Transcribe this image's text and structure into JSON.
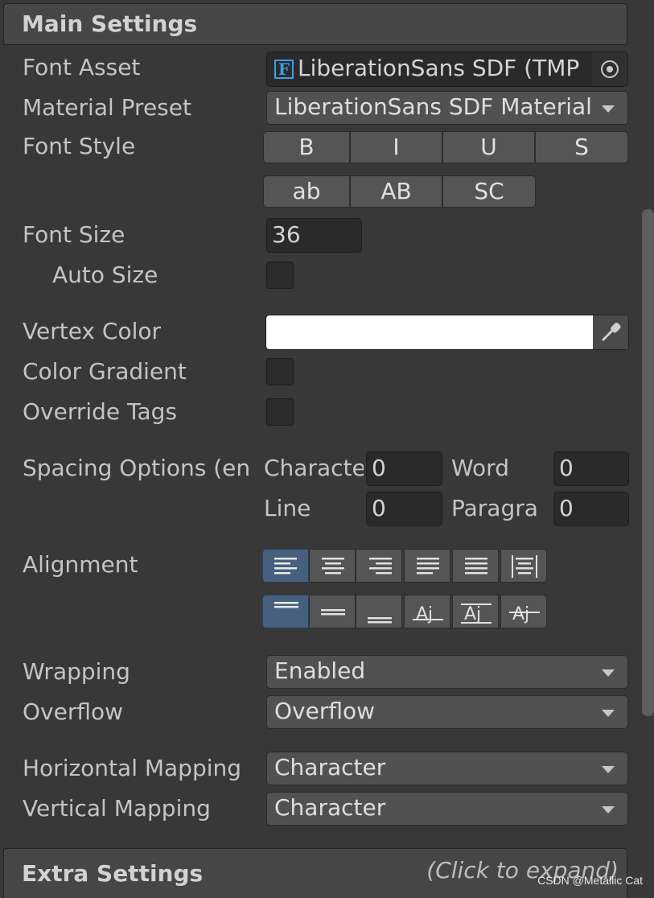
{
  "main_settings": {
    "title": "Main Settings"
  },
  "font_asset": {
    "label": "Font Asset",
    "value": "LiberationSans SDF (TMP",
    "icon": "F"
  },
  "material_preset": {
    "label": "Material Preset",
    "value": "LiberationSans SDF Material"
  },
  "font_style": {
    "label": "Font Style",
    "row1": [
      "B",
      "I",
      "U",
      "S"
    ],
    "row2": [
      "ab",
      "AB",
      "SC"
    ]
  },
  "font_size": {
    "label": "Font Size",
    "value": "36"
  },
  "auto_size": {
    "label": "Auto Size",
    "checked": false
  },
  "vertex_color": {
    "label": "Vertex Color",
    "color": "#ffffff"
  },
  "color_gradient": {
    "label": "Color Gradient",
    "checked": false
  },
  "override_tags": {
    "label": "Override Tags",
    "checked": false
  },
  "spacing": {
    "label": "Spacing Options (en",
    "character_label": "Characte",
    "character_value": "0",
    "word_label": "Word",
    "word_value": "0",
    "line_label": "Line",
    "line_value": "0",
    "paragraph_label": "Paragra",
    "paragraph_value": "0"
  },
  "alignment": {
    "label": "Alignment",
    "horizontal": [
      "align-left-icon",
      "align-center-icon",
      "align-right-icon",
      "align-justify-icon",
      "align-flush-icon",
      "align-geo-icon"
    ],
    "vertical": [
      "align-top-icon",
      "align-middle-icon",
      "align-bottom-icon",
      "align-baseline-icon",
      "align-midline-icon",
      "align-capline-icon"
    ],
    "active_horizontal": 0,
    "active_vertical": 0
  },
  "wrapping": {
    "label": "Wrapping",
    "value": "Enabled"
  },
  "overflow": {
    "label": "Overflow",
    "value": "Overflow"
  },
  "horizontal_mapping": {
    "label": "Horizontal Mapping",
    "value": "Character"
  },
  "vertical_mapping": {
    "label": "Vertical Mapping",
    "value": "Character"
  },
  "extra_settings": {
    "title": "Extra Settings",
    "hint": "(Click to expand)"
  },
  "watermark": "CSDN @Metallic Cat",
  "colors": {
    "panel": "#383838",
    "header": "#464646",
    "active_button": "#46607e",
    "icon_blue": "#3aa0e6"
  }
}
